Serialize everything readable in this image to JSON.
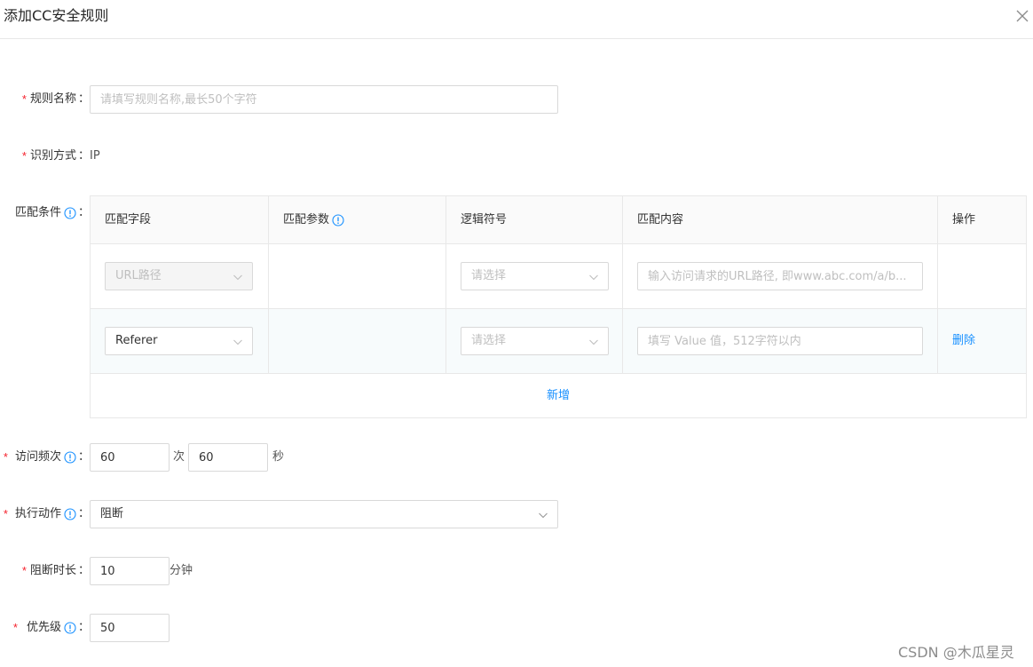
{
  "dialog": {
    "title": "添加CC安全规则"
  },
  "form": {
    "rule_name": {
      "label": "规则名称",
      "placeholder": "请填写规则名称,最长50个字符",
      "value": ""
    },
    "identify": {
      "label": "识别方式",
      "value": "IP"
    },
    "match": {
      "label": "匹配条件",
      "columns": [
        "匹配字段",
        "匹配参数",
        "逻辑符号",
        "匹配内容",
        "操作"
      ],
      "rows": [
        {
          "field": "URL路径",
          "logic_placeholder": "请选择",
          "content_placeholder": "输入访问请求的URL路径, 即www.abc.com/a/b...",
          "action": ""
        },
        {
          "field": "Referer",
          "logic_placeholder": "请选择",
          "content_placeholder": "填写 Value 值，512字符以内",
          "action": "删除"
        }
      ],
      "add_label": "新增"
    },
    "frequency": {
      "label": "访问频次",
      "count": "60",
      "count_unit": "次",
      "seconds": "60",
      "seconds_unit": "秒"
    },
    "action": {
      "label": "执行动作",
      "value": "阻断"
    },
    "block_duration": {
      "label": "阻断时长",
      "value": "10",
      "unit": "分钟"
    },
    "priority": {
      "label": "优先级",
      "value": "50"
    },
    "colon": "：",
    "required_mark": "*"
  },
  "watermark": "CSDN @木瓜星灵",
  "colors": {
    "accent": "#1890ff",
    "required": "#f5222d",
    "border": "#d9d9d9"
  }
}
